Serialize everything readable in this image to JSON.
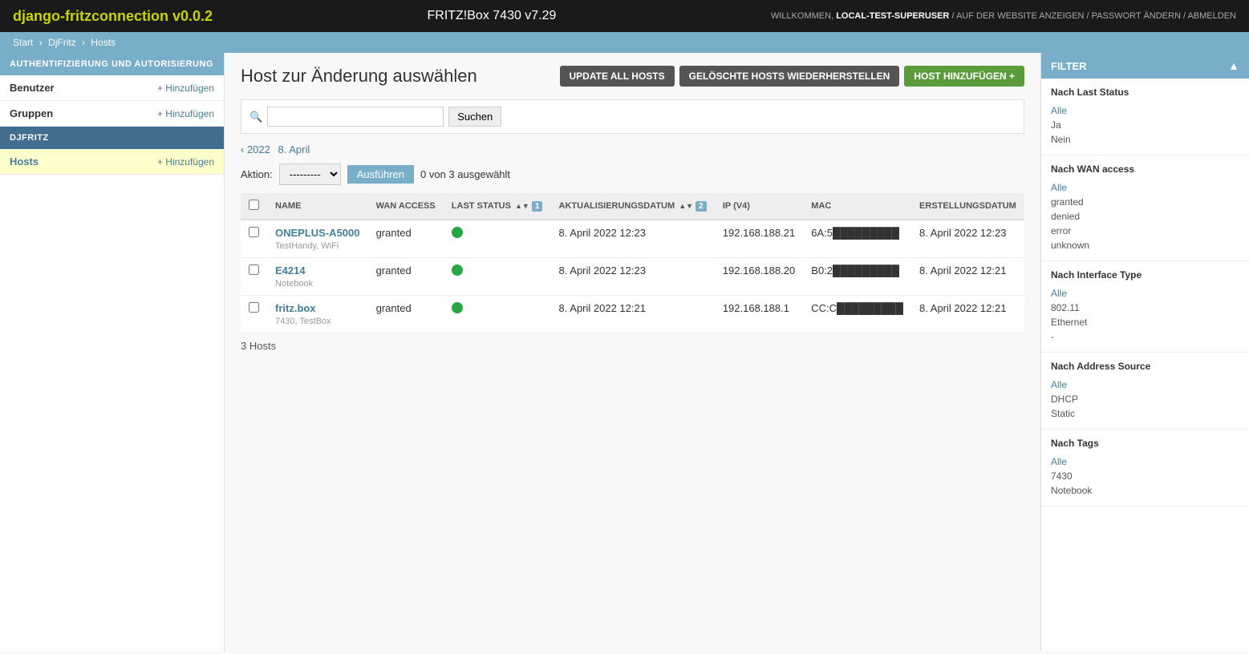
{
  "header": {
    "app_title": "django-fritzconnection v0.0.2",
    "fritz_box": "FRITZ!Box 7430 v7.29",
    "welcome_text": "WILLKOMMEN,",
    "username": "LOCAL-TEST-SUPERUSER",
    "nav_links": [
      "AUF DER WEBSITE ANZEIGEN",
      "PASSWORT ÄNDERN",
      "ABMELDEN"
    ]
  },
  "breadcrumb": {
    "items": [
      "Start",
      "DjFritz",
      "Hosts"
    ]
  },
  "sidebar": {
    "auth_section_label": "AUTHENTIFIZIERUNG UND AUTORISIERUNG",
    "benutzer_label": "Benutzer",
    "benutzer_add": "+ Hinzufügen",
    "gruppen_label": "Gruppen",
    "gruppen_add": "+ Hinzufügen",
    "djfritz_section_label": "DJFRITZ",
    "hosts_label": "Hosts",
    "hosts_add": "+ Hinzufügen"
  },
  "page": {
    "title": "Host zur Änderung auswählen",
    "btn_update_all": "UPDATE ALL HOSTS",
    "btn_restore": "GELÖSCHTE HOSTS WIEDERHERSTELLEN",
    "btn_add_host": "HOST HINZUFÜGEN +",
    "search_placeholder": "",
    "search_btn": "Suchen",
    "date_nav_back": "‹ 2022",
    "date_nav_current": "8. April",
    "action_label": "Aktion:",
    "action_placeholder": "---------",
    "action_btn": "Ausführen",
    "selection_info": "0 von 3 ausgewählt"
  },
  "table": {
    "columns": [
      {
        "id": "name",
        "label": "NAME",
        "sortable": false
      },
      {
        "id": "wan_access",
        "label": "WAN ACCESS",
        "sortable": false
      },
      {
        "id": "last_status",
        "label": "LAST STATUS",
        "sort_num": "1",
        "sortable": true
      },
      {
        "id": "aktualisierungsdatum",
        "label": "AKTUALISIERUNGSDATUM",
        "sort_num": "2",
        "sortable": true
      },
      {
        "id": "ip_v4",
        "label": "IP (V4)",
        "sortable": false
      },
      {
        "id": "mac",
        "label": "MAC",
        "sortable": false
      },
      {
        "id": "erstellungsdatum",
        "label": "ERSTELLUNGSDATUM",
        "sortable": false
      }
    ],
    "rows": [
      {
        "name": "ONEPLUS-A5000",
        "sub": "TestHandy, WiFi",
        "wan_access": "granted",
        "last_status": "green",
        "aktualisierungsdatum": "8. April 2022 12:23",
        "ip_v4": "192.168.188.21",
        "mac": "6A:5█████████",
        "erstellungsdatum": "8. April 2022 12:23"
      },
      {
        "name": "E4214",
        "sub": "Notebook",
        "wan_access": "granted",
        "last_status": "green",
        "aktualisierungsdatum": "8. April 2022 12:23",
        "ip_v4": "192.168.188.20",
        "mac": "B0:2█████████",
        "erstellungsdatum": "8. April 2022 12:21"
      },
      {
        "name": "fritz.box",
        "sub": "7430, TestBox",
        "wan_access": "granted",
        "last_status": "green",
        "aktualisierungsdatum": "8. April 2022 12:21",
        "ip_v4": "192.168.188.1",
        "mac": "CC:C█████████",
        "erstellungsdatum": "8. April 2022 12:21"
      }
    ],
    "total_label": "3 Hosts"
  },
  "filter": {
    "header": "FILTER",
    "sections": [
      {
        "title": "Nach Last Status",
        "items": [
          {
            "label": "Alle",
            "link": true
          },
          {
            "label": "Ja",
            "link": false
          },
          {
            "label": "Nein",
            "link": false
          }
        ]
      },
      {
        "title": "Nach WAN access",
        "items": [
          {
            "label": "Alle",
            "link": true
          },
          {
            "label": "granted",
            "link": false
          },
          {
            "label": "denied",
            "link": false
          },
          {
            "label": "error",
            "link": false
          },
          {
            "label": "unknown",
            "link": false
          }
        ]
      },
      {
        "title": "Nach Interface Type",
        "items": [
          {
            "label": "Alle",
            "link": true
          },
          {
            "label": "802.11",
            "link": false
          },
          {
            "label": "Ethernet",
            "link": false
          },
          {
            "label": "-",
            "link": false
          }
        ]
      },
      {
        "title": "Nach Address Source",
        "items": [
          {
            "label": "Alle",
            "link": true
          },
          {
            "label": "DHCP",
            "link": false
          },
          {
            "label": "Static",
            "link": false
          }
        ]
      },
      {
        "title": "Nach Tags",
        "items": [
          {
            "label": "Alle",
            "link": true
          },
          {
            "label": "7430",
            "link": false
          },
          {
            "label": "Notebook",
            "link": false
          }
        ]
      }
    ]
  }
}
